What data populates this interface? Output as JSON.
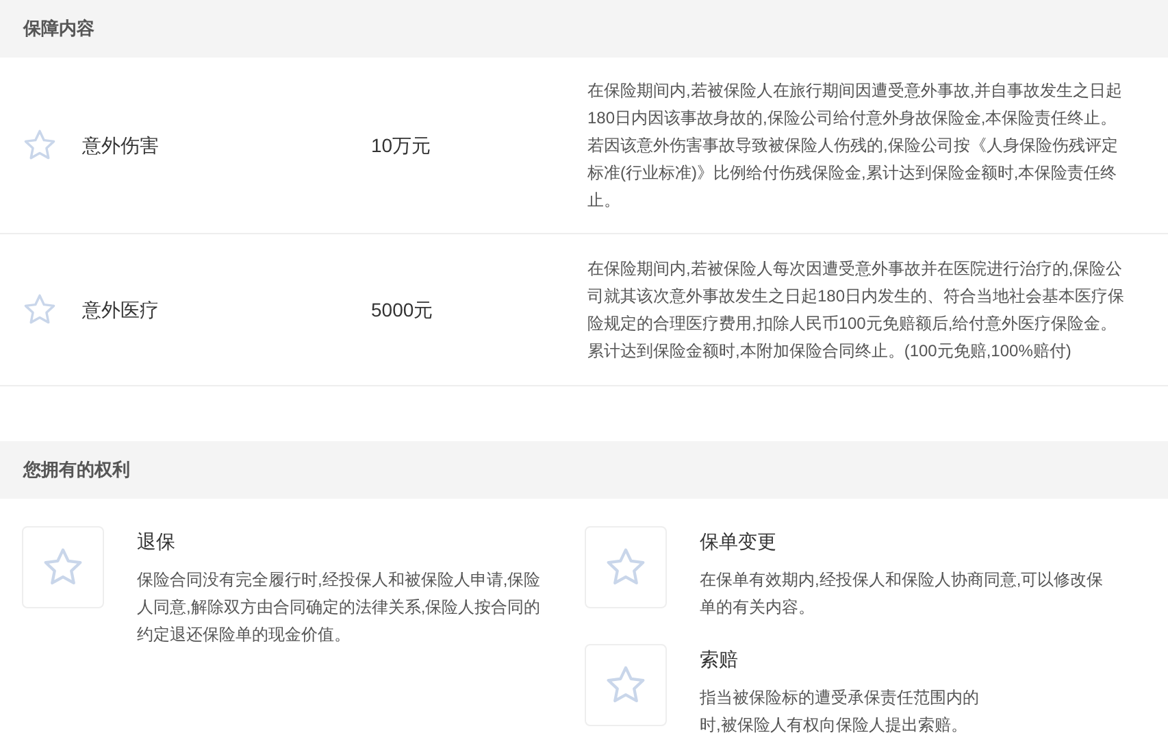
{
  "coverage": {
    "title": "保障内容",
    "items": [
      {
        "name": "意外伤害",
        "amount": "10万元",
        "description": "在保险期间内,若被保险人在旅行期间因遭受意外事故,并自事故发生之日起180日内因该事故身故的,保险公司给付意外身故保险金,本保险责任终止。若因该意外伤害事故导致被保险人伤残的,保险公司按《人身保险伤残评定标准(行业标准)》比例给付伤残保险金,累计达到保险金额时,本保险责任终止。"
      },
      {
        "name": "意外医疗",
        "amount": "5000元",
        "description": "在保险期间内,若被保险人每次因遭受意外事故并在医院进行治疗的,保险公司就其该次意外事故发生之日起180日内发生的、符合当地社会基本医疗保险规定的合理医疗费用,扣除人民币100元免赔额后,给付意外医疗保险金。累计达到保险金额时,本附加保险合同终止。(100元免赔,100%赔付)"
      }
    ]
  },
  "rights": {
    "title": "您拥有的权利",
    "items": [
      {
        "name": "退保",
        "description_lines": [
          "保险合同没有完全履行时,经投保人和被保险人申请,保险人同意,解除双方由合同确定的法律关系,保险人按合同的约定退还保险单的现金价值。"
        ]
      },
      {
        "name": "保单变更",
        "description_lines": [
          "在保单有效期内,经投保人和保险人协商同意,可以修改保单的有关内容。"
        ]
      },
      {
        "name": "索赔",
        "description_lines": [
          "指当被保险标的遭受承保责任范围内的",
          "时,被保险人有权向保险人提出索赔。"
        ]
      }
    ]
  }
}
